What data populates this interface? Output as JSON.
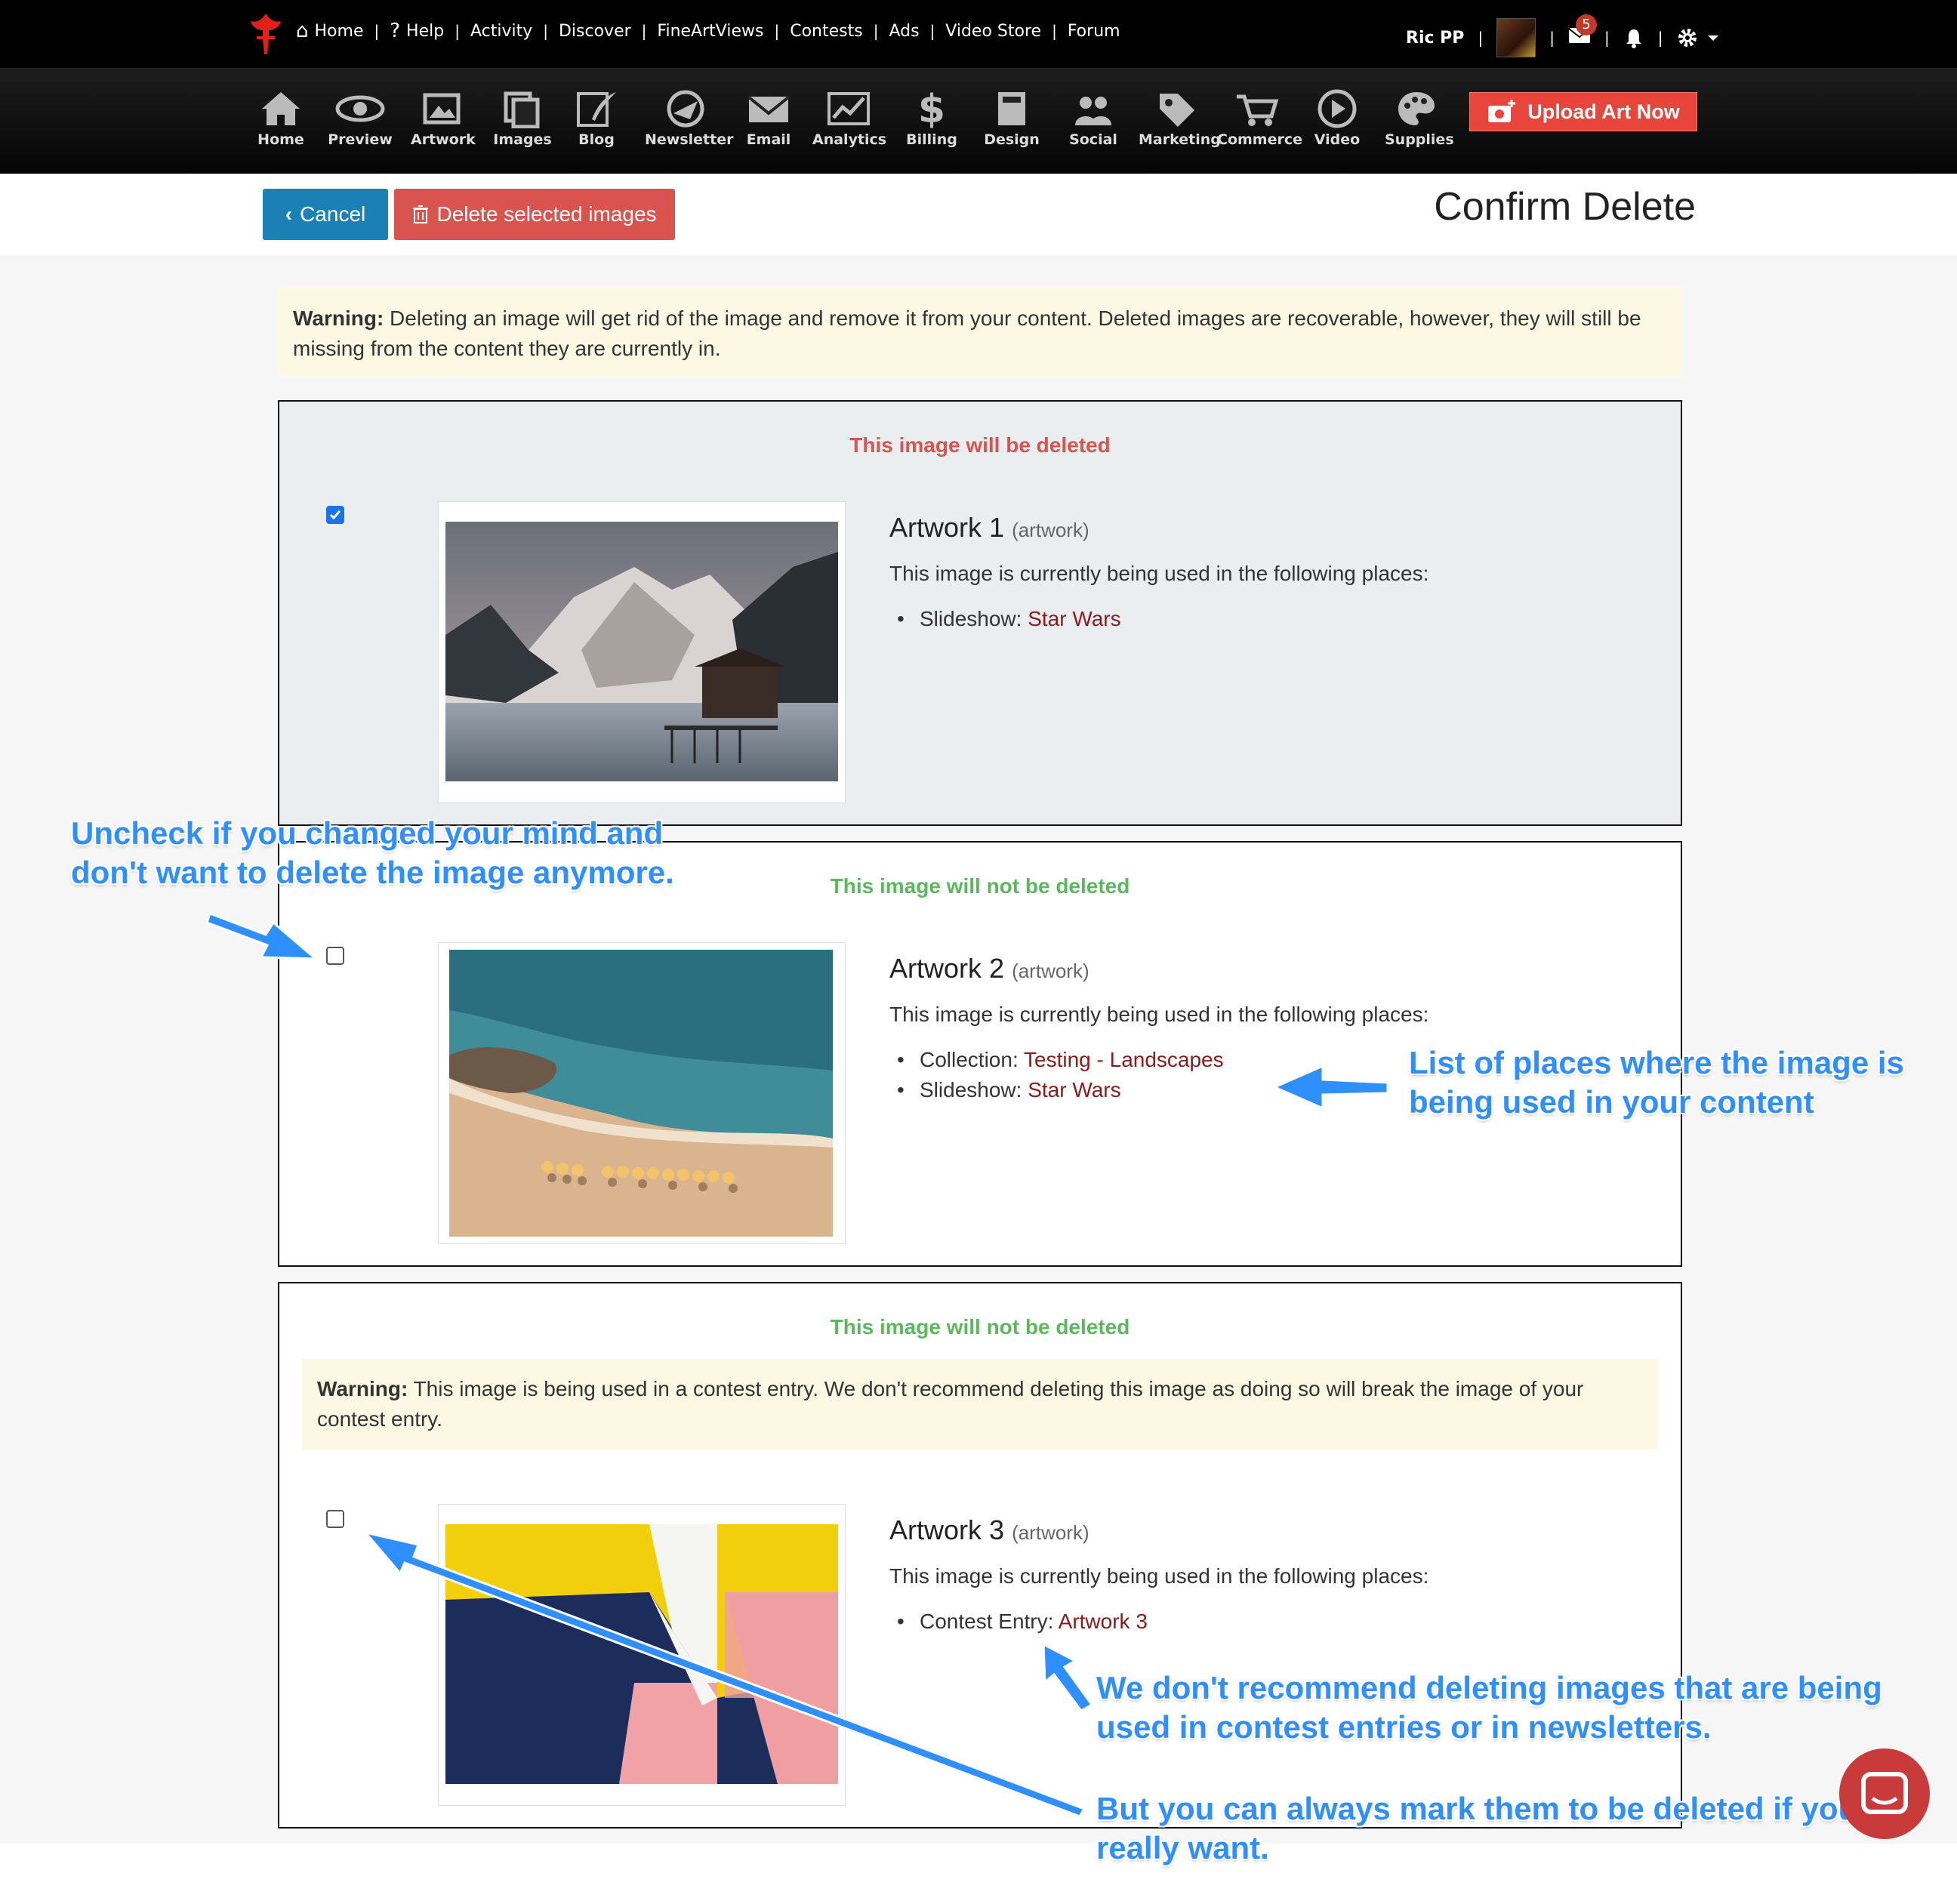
{
  "topnav": {
    "links": [
      "Home",
      "Help",
      "Activity",
      "Discover",
      "FineArtViews",
      "Contests",
      "Ads",
      "Video Store",
      "Forum"
    ],
    "user_name": "Ric PP",
    "mail_badge": "5"
  },
  "toolbar": {
    "items": [
      "Home",
      "Preview",
      "Artwork",
      "Images",
      "Blog",
      "Newsletter",
      "Email",
      "Analytics",
      "Billing",
      "Design",
      "Social",
      "Marketing",
      "Commerce",
      "Video",
      "Supplies"
    ],
    "upload_label": "Upload Art Now"
  },
  "header": {
    "cancel_label": "Cancel",
    "delete_label": "Delete selected images",
    "page_title": "Confirm Delete"
  },
  "warning": {
    "bold": "Warning:",
    "text": " Deleting an image will get rid of the image and remove it from your content. Deleted images are recoverable, however, they will still be missing from the content they are currently in."
  },
  "cards": [
    {
      "status": "This image will be deleted",
      "status_color": "#d9534f",
      "checked": true,
      "title": "Artwork 1",
      "tag": "(artwork)",
      "used_text": "This image is currently being used in the following places:",
      "places": [
        {
          "label": "Slideshow: ",
          "link": "Star Wars"
        }
      ]
    },
    {
      "status": "This image will not be deleted",
      "status_color": "#5cb85c",
      "checked": false,
      "title": "Artwork 2",
      "tag": "(artwork)",
      "used_text": "This image is currently being used in the following places:",
      "places": [
        {
          "label": "Collection: ",
          "link": "Testing - Landscapes"
        },
        {
          "label": "Slideshow: ",
          "link": "Star Wars"
        }
      ]
    },
    {
      "status": "This image will not be deleted",
      "status_color": "#5cb85c",
      "checked": false,
      "warning_bold": "Warning:",
      "warning_text": " This image is being used in a contest entry. We don't recommend deleting this image as doing so will break the image of your contest entry.",
      "title": "Artwork 3",
      "tag": "(artwork)",
      "used_text": "This image is currently being used in the following places:",
      "places": [
        {
          "label": "Contest Entry: ",
          "link": "Artwork 3"
        }
      ]
    }
  ],
  "annotations": {
    "uncheck_1": "Uncheck if you changed your mind and",
    "uncheck_2": "don't want to delete the image anymore.",
    "list_1": "List of places where the image is",
    "list_2": "being used in your content",
    "recommend_1": "We don't recommend deleting images that are being",
    "recommend_2": "used in contest entries or in newsletters.",
    "always_1": "But you can always mark them to be deleted if you",
    "always_2": "really want."
  },
  "colors": {
    "accent_blue": "#1a80b6",
    "danger_red": "#d9534f",
    "success_green": "#5cb85c",
    "annotation_blue": "#2f8fff",
    "link_red": "#8b1a1a"
  }
}
